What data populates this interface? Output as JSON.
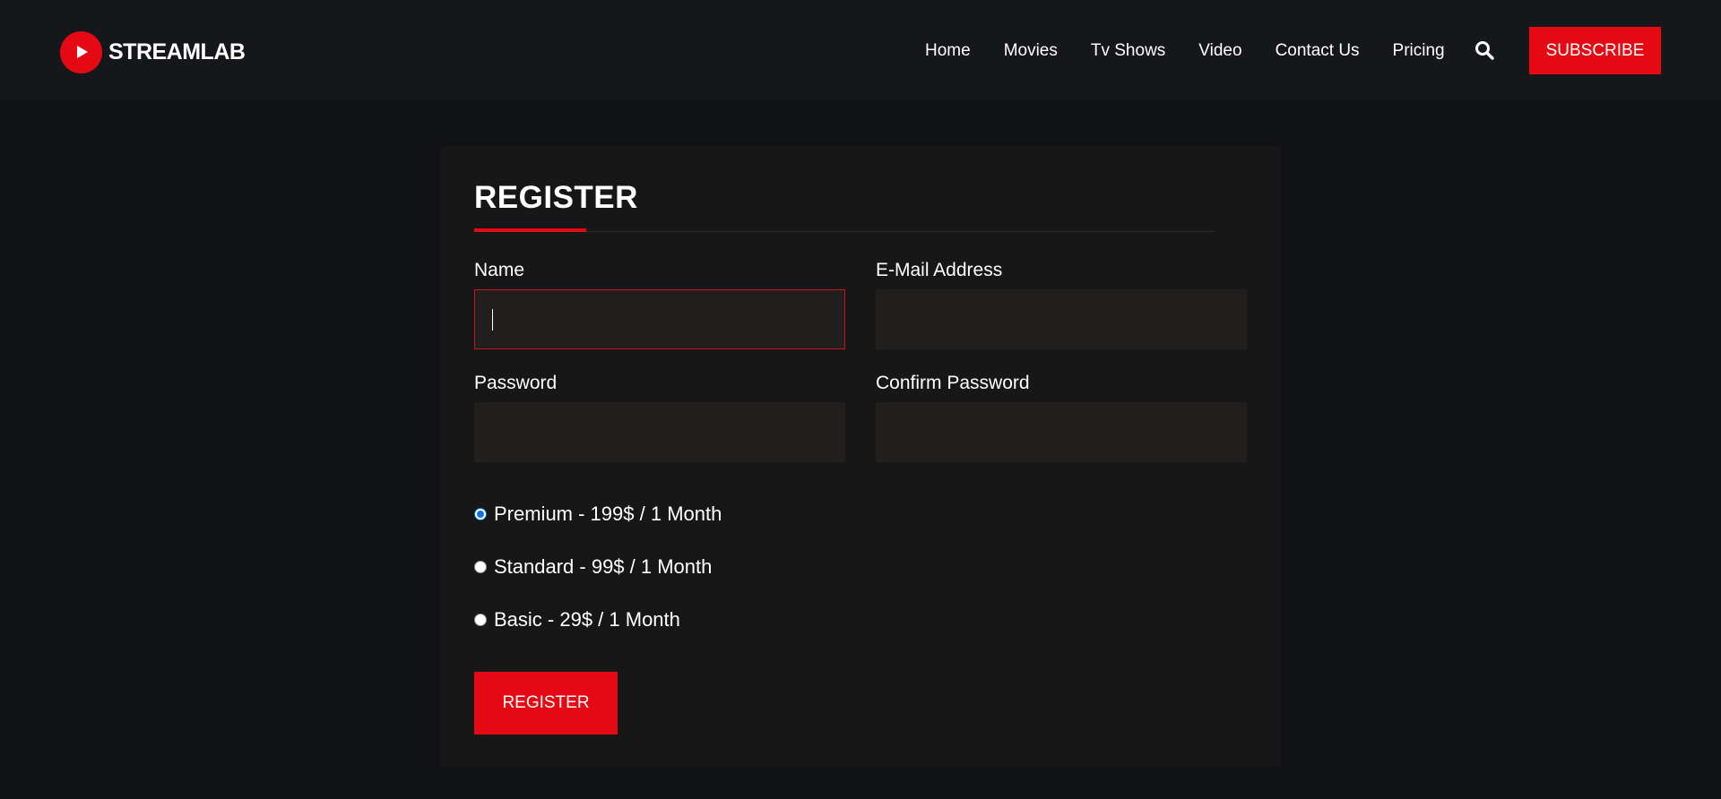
{
  "brand": {
    "name": "STREAMLAB",
    "logo_icon": "play-icon",
    "accent_color": "#e50914"
  },
  "nav": {
    "items": [
      {
        "label": "Home"
      },
      {
        "label": "Movies"
      },
      {
        "label": "Tv Shows"
      },
      {
        "label": "Video"
      },
      {
        "label": "Contact Us"
      },
      {
        "label": "Pricing"
      }
    ],
    "search_icon": "search-icon",
    "subscribe_label": "SUBSCRIBE"
  },
  "register": {
    "title": "REGISTER",
    "fields": {
      "name": {
        "label": "Name",
        "value": ""
      },
      "email": {
        "label": "E-Mail Address",
        "value": ""
      },
      "password": {
        "label": "Password",
        "value": ""
      },
      "confirm_password": {
        "label": "Confirm Password",
        "value": ""
      }
    },
    "plans": [
      {
        "label": "Premium - 199$ / 1 Month",
        "selected": true
      },
      {
        "label": "Standard - 99$ / 1 Month",
        "selected": false
      },
      {
        "label": "Basic - 29$ / 1 Month",
        "selected": false
      }
    ],
    "submit_label": "REGISTER"
  }
}
